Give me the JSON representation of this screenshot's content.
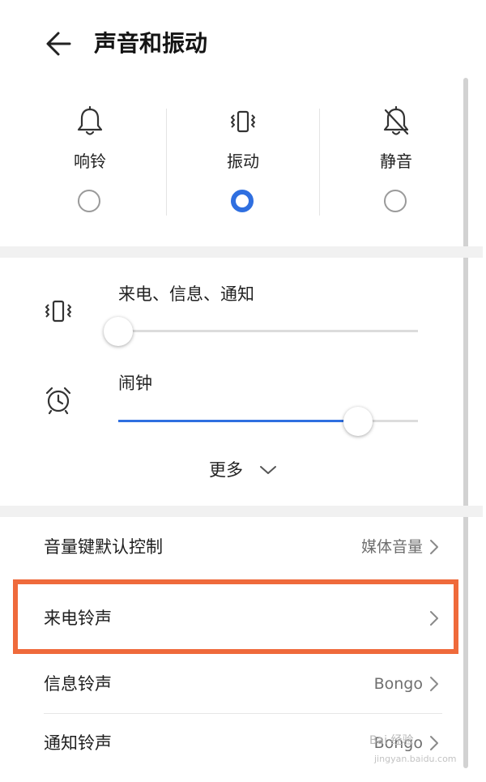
{
  "header": {
    "title": "声音和振动"
  },
  "modes": [
    {
      "label": "响铃",
      "icon": "bell-icon",
      "selected": false
    },
    {
      "label": "振动",
      "icon": "vibrate-icon",
      "selected": true
    },
    {
      "label": "静音",
      "icon": "bell-off-icon",
      "selected": false
    }
  ],
  "volumes": [
    {
      "label": "来电、信息、通知",
      "icon": "vibrate-icon",
      "level": 0.0
    },
    {
      "label": "闹钟",
      "icon": "alarm-clock-icon",
      "level": 0.8
    }
  ],
  "more": {
    "label": "更多"
  },
  "settings": [
    {
      "label": "音量键默认控制",
      "value": "媒体音量"
    },
    {
      "label": "来电铃声",
      "value": ""
    },
    {
      "label": "信息铃声",
      "value": "Bongo"
    },
    {
      "label": "通知铃声",
      "value": "Bongo"
    }
  ],
  "watermark": {
    "line1": "Bai 经验",
    "line2": "jingyan.baidu.com"
  },
  "colors": {
    "accent": "#2f6fe0",
    "highlight": "#ef6a3b"
  }
}
